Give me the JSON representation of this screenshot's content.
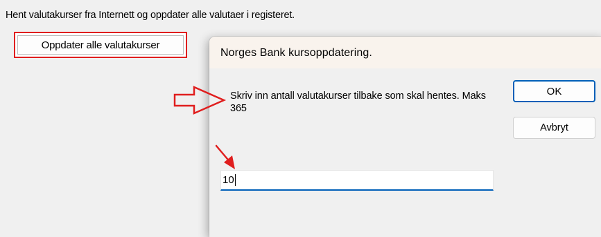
{
  "background_window": {
    "instruction_text": "Hent valutakurser fra Internett og oppdater alle valutaer i registeret.",
    "update_button_label": "Oppdater alle valutakurser"
  },
  "dialog": {
    "title": "Norges Bank kursoppdatering.",
    "prompt": "Skriv inn antall valutakurser tilbake som skal hentes. Maks 365",
    "ok_label": "OK",
    "cancel_label": "Avbryt",
    "input_value": "10"
  },
  "colors": {
    "annotation_red": "#e01e1e",
    "focus_blue": "#005fb8",
    "titlebar_bg": "#f9f3ed",
    "window_bg": "#f0f0f0"
  },
  "annotations": [
    {
      "type": "hollow-arrow",
      "points_to": "prompt-text"
    },
    {
      "type": "arrow",
      "points_to": "input-field"
    }
  ]
}
